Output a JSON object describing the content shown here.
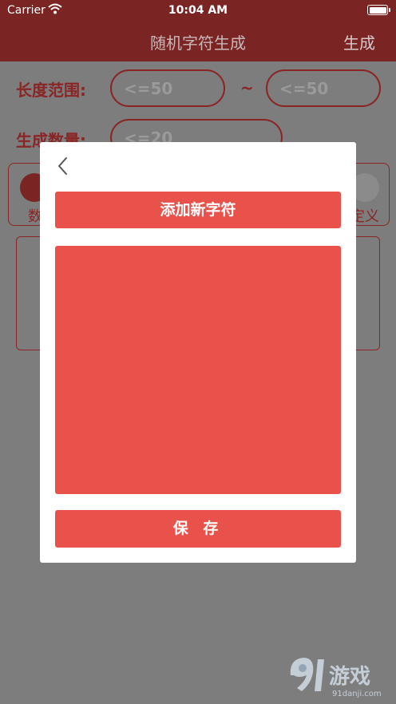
{
  "status_bar": {
    "carrier": "Carrier",
    "time": "10:04 AM"
  },
  "nav": {
    "title": "随机字符生成",
    "generate_label": "生成"
  },
  "form": {
    "length_label": "长度范围:",
    "length_min_placeholder": "<=50",
    "length_max_placeholder": "<=50",
    "range_separator": "~",
    "count_label": "生成数量:",
    "count_placeholder": "<=20",
    "option_left_label": "数",
    "option_right_label": "定义"
  },
  "modal": {
    "add_button_label": "添加新字符",
    "save_button_label": "保 存"
  },
  "watermark": {
    "brand_text": "91游戏",
    "url_text": "91danji.com"
  },
  "colors": {
    "accent": "#e8524b",
    "nav_background": "#7a2424",
    "overlay_background": "#7d7d7d",
    "modal_background": "#ffffff"
  }
}
